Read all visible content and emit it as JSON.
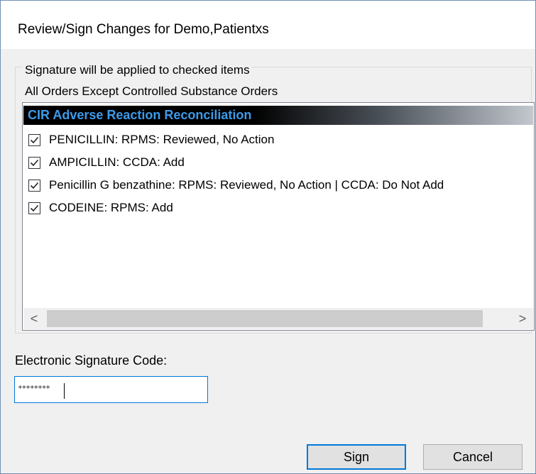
{
  "window": {
    "title": "Review/Sign Changes for Demo,Patientxs"
  },
  "group": {
    "legend": "Signature will be applied to checked items",
    "sublabel": "All Orders Except Controlled Substance Orders"
  },
  "list": {
    "header": "CIR Adverse Reaction Reconciliation",
    "items": [
      {
        "label": "PENICILLIN: RPMS: Reviewed, No Action",
        "checked": true
      },
      {
        "label": "AMPICILLIN: CCDA: Add",
        "checked": true
      },
      {
        "label": "Penicillin G benzathine: RPMS: Reviewed, No Action | CCDA: Do Not Add",
        "checked": true
      },
      {
        "label": "CODEINE: RPMS: Add",
        "checked": true
      }
    ],
    "scroll_left": "<",
    "scroll_right": ">"
  },
  "signature": {
    "label": "Electronic Signature Code:",
    "value": "********"
  },
  "buttons": {
    "sign": "Sign",
    "cancel": "Cancel"
  },
  "colors": {
    "header_text": "#3c9bea",
    "focus_border": "#0078d7"
  }
}
